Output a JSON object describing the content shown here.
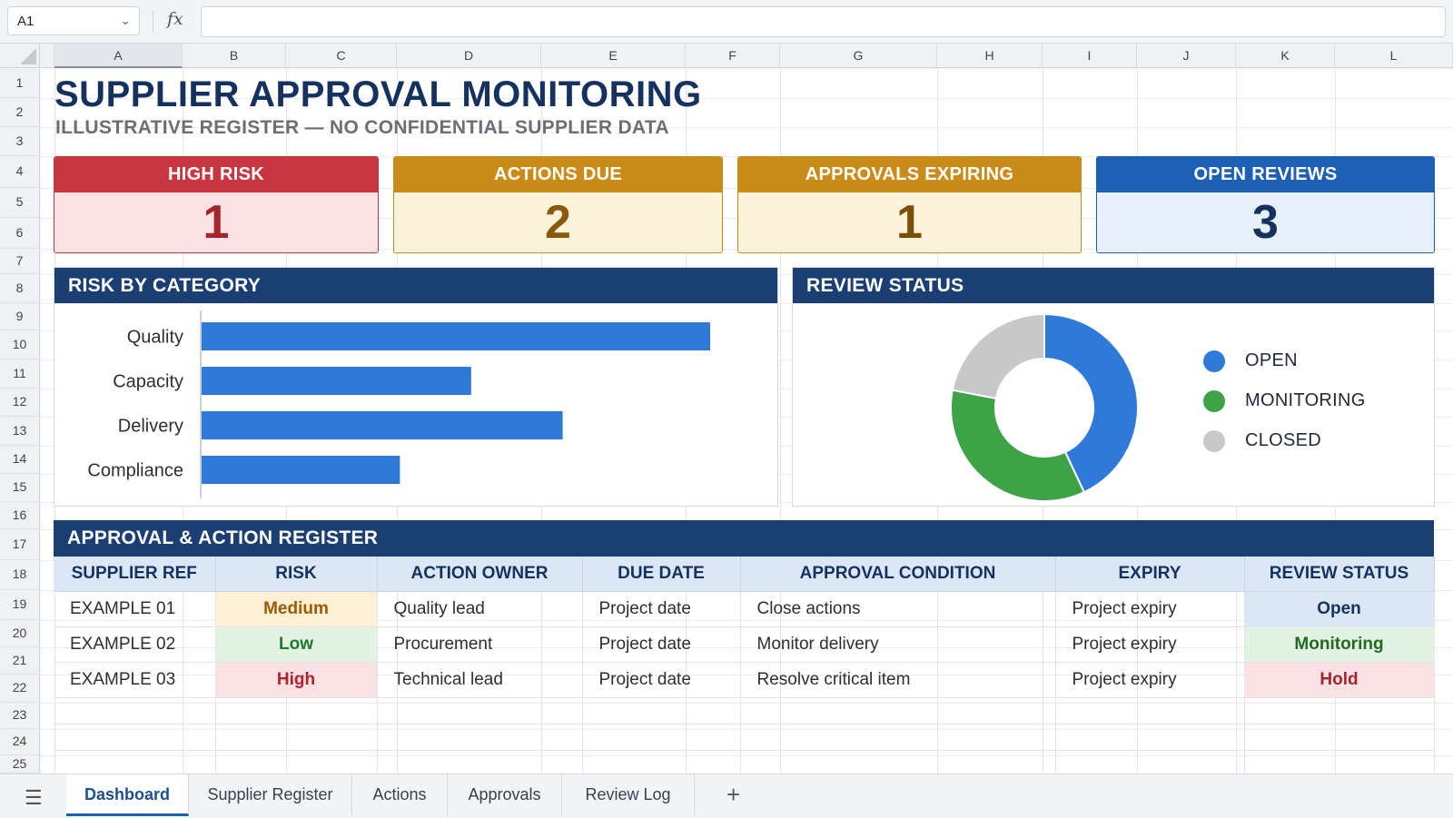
{
  "formula_bar": {
    "cell_ref": "A1",
    "fx_label": "fx",
    "formula": ""
  },
  "columns": [
    "A",
    "B",
    "C",
    "D",
    "E",
    "F",
    "G",
    "H",
    "I",
    "J",
    "K",
    "L"
  ],
  "rows": [
    "1",
    "2",
    "3",
    "4",
    "5",
    "6",
    "7",
    "8",
    "9",
    "10",
    "11",
    "12",
    "13",
    "14",
    "15",
    "16",
    "17",
    "18",
    "19",
    "20",
    "21",
    "22",
    "23",
    "24",
    "25"
  ],
  "title": "SUPPLIER APPROVAL MONITORING",
  "subtitle": "ILLUSTRATIVE REGISTER — NO CONFIDENTIAL SUPPLIER DATA",
  "kpis": [
    {
      "label": "HIGH RISK",
      "value": "1",
      "head_color": "#c6373f",
      "body_color": "#fbe1e3",
      "value_color": "#a3262e"
    },
    {
      "label": "ACTIONS DUE",
      "value": "2",
      "head_color": "#c98c18",
      "body_color": "#fdf3da",
      "value_color": "#8a5a0c"
    },
    {
      "label": "APPROVALS EXPIRING",
      "value": "1",
      "head_color": "#c98c18",
      "body_color": "#fdf3da",
      "value_color": "#7a4f0a"
    },
    {
      "label": "OPEN REVIEWS",
      "value": "3",
      "head_color": "#1d5fb4",
      "body_color": "#e6f0fb",
      "value_color": "#15325f"
    }
  ],
  "risk_panel": {
    "title": "RISK BY CATEGORY"
  },
  "status_panel": {
    "title": "REVIEW STATUS"
  },
  "chart_data": [
    {
      "type": "bar",
      "orientation": "horizontal",
      "title": "RISK BY CATEGORY",
      "categories": [
        "Quality",
        "Capacity",
        "Delivery",
        "Compliance"
      ],
      "values": [
        100,
        53,
        71,
        39
      ],
      "xlim": [
        0,
        100
      ],
      "grid": false,
      "color": "#2f7ad8"
    },
    {
      "type": "pie",
      "style": "donut",
      "title": "REVIEW STATUS",
      "labels": [
        "OPEN",
        "MONITORING",
        "CLOSED"
      ],
      "values": [
        43,
        35,
        22
      ],
      "colors": [
        "#2f7ad8",
        "#3ea346",
        "#c8c8c8"
      ],
      "legend": "right"
    }
  ],
  "register": {
    "title": "APPROVAL & ACTION REGISTER",
    "headers": [
      "SUPPLIER REF",
      "RISK",
      "ACTION OWNER",
      "DUE DATE",
      "APPROVAL CONDITION",
      "EXPIRY",
      "REVIEW STATUS"
    ],
    "rows": [
      {
        "ref": "EXAMPLE 01",
        "risk": "Medium",
        "owner": "Quality lead",
        "due": "Project date",
        "condition": "Close actions",
        "expiry": "Project expiry",
        "status": "Open"
      },
      {
        "ref": "EXAMPLE 02",
        "risk": "Low",
        "owner": "Procurement",
        "due": "Project date",
        "condition": "Monitor delivery",
        "expiry": "Project expiry",
        "status": "Monitoring"
      },
      {
        "ref": "EXAMPLE 03",
        "risk": "High",
        "owner": "Technical lead",
        "due": "Project date",
        "condition": "Resolve critical item",
        "expiry": "Project expiry",
        "status": "Hold"
      }
    ],
    "risk_styles": {
      "Medium": {
        "bg": "#fdf0d5",
        "fg": "#9a5c00"
      },
      "Low": {
        "bg": "#e3f3e3",
        "fg": "#1f7a2e"
      },
      "High": {
        "bg": "#fbe1e3",
        "fg": "#b0222c"
      }
    },
    "status_styles": {
      "Open": {
        "bg": "#dbe7f5",
        "fg": "#15325f"
      },
      "Monitoring": {
        "bg": "#e3f3e3",
        "fg": "#1f6b1f"
      },
      "Hold": {
        "bg": "#fbe1e3",
        "fg": "#a3262e"
      }
    }
  },
  "tabs": [
    {
      "label": "Dashboard",
      "active": true
    },
    {
      "label": "Supplier Register",
      "active": false
    },
    {
      "label": "Actions",
      "active": false
    },
    {
      "label": "Approvals",
      "active": false
    },
    {
      "label": "Review Log",
      "active": false
    }
  ],
  "add_tab_label": "+",
  "icons": {
    "menu": "hamburger-menu-icon",
    "add": "plus-icon",
    "dropdown": "chevron-down-icon"
  }
}
